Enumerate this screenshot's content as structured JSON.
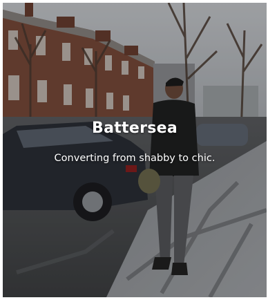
{
  "card": {
    "title": "Battersea",
    "subtitle": "Converting from shabby to chic.",
    "image_alt": "photo-street-scene"
  },
  "colors": {
    "text": "#ffffff",
    "overlay": "rgba(0,0,0,0.22)"
  }
}
